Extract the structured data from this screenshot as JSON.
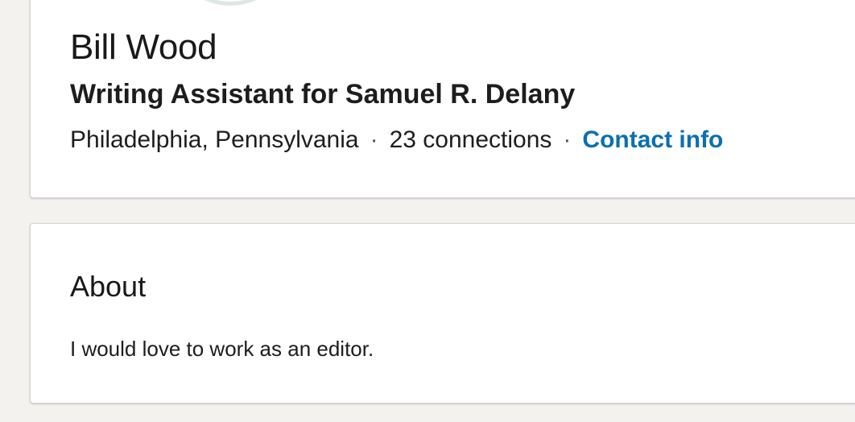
{
  "profile": {
    "name": "Bill Wood",
    "headline": "Writing Assistant for Samuel R. Delany",
    "location": "Philadelphia, Pennsylvania",
    "separator": "·",
    "connections": "23 connections",
    "contact_info_label": "Contact info"
  },
  "about": {
    "title": "About",
    "text": "I would love to work as an editor."
  },
  "colors": {
    "link": "#0b6fb0",
    "background": "#f3f2ef",
    "card": "#ffffff"
  }
}
